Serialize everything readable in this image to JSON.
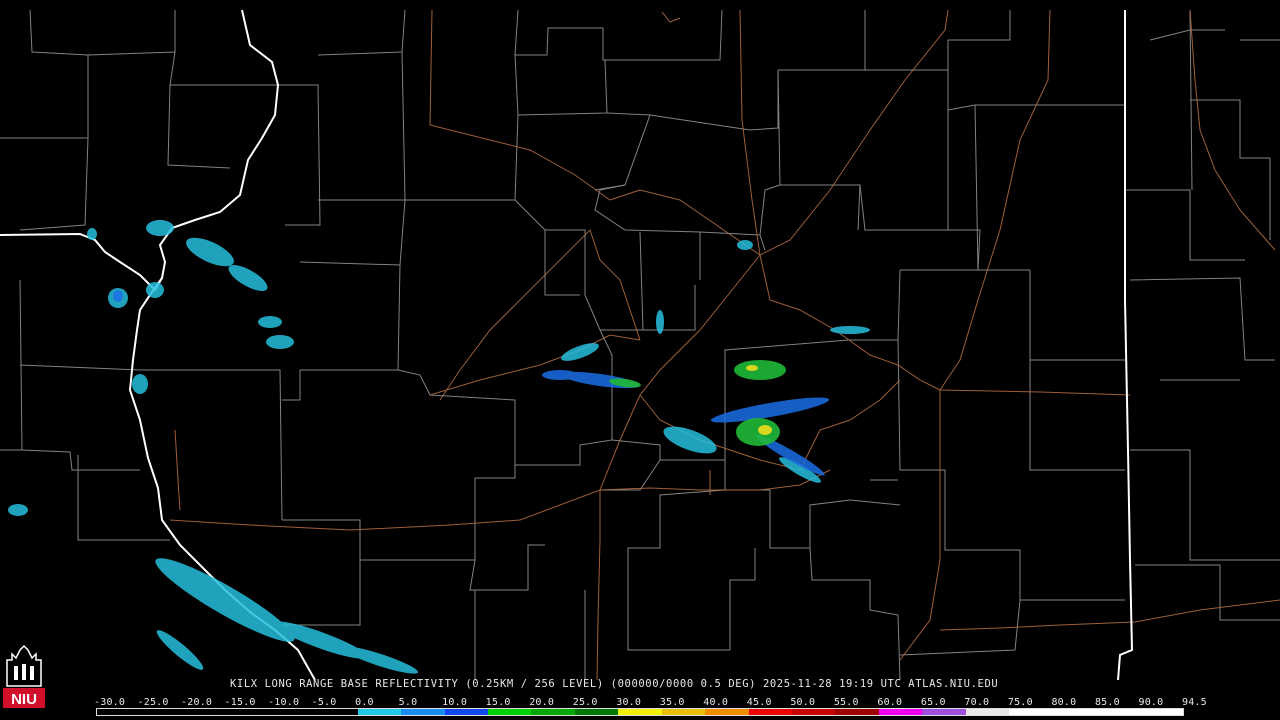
{
  "product": {
    "caption": "KILX LONG RANGE BASE REFLECTIVITY (0.25KM / 256 LEVEL) (000000/0000 0.5 DEG) 2025-11-28 19:19 UTC  ATLAS.NIU.EDU"
  },
  "logo": {
    "text": "NIU",
    "icon": "niu-castle-logo"
  },
  "colorbar": {
    "ticks": [
      "-30.0",
      "-25.0",
      "-20.0",
      "-15.0",
      "-10.0",
      "-5.0",
      "0.0",
      "5.0",
      "10.0",
      "15.0",
      "20.0",
      "25.0",
      "30.0",
      "35.0",
      "40.0",
      "45.0",
      "50.0",
      "55.0",
      "60.0",
      "65.0",
      "70.0",
      "75.0",
      "80.0",
      "85.0",
      "90.0",
      "94.5"
    ],
    "colors": [
      "#000000",
      "#000000",
      "#000000",
      "#000000",
      "#000000",
      "#000000",
      "#20c8e8",
      "#1a8ef0",
      "#1048f0",
      "#00d000",
      "#00a800",
      "#007800",
      "#f0f000",
      "#e8c000",
      "#f08c00",
      "#f00000",
      "#c80000",
      "#a00000",
      "#f000f0",
      "#a050e0",
      "#e8e8e8",
      "#ffffff",
      "#ffffff",
      "#ffffff",
      "#ffffff"
    ]
  }
}
